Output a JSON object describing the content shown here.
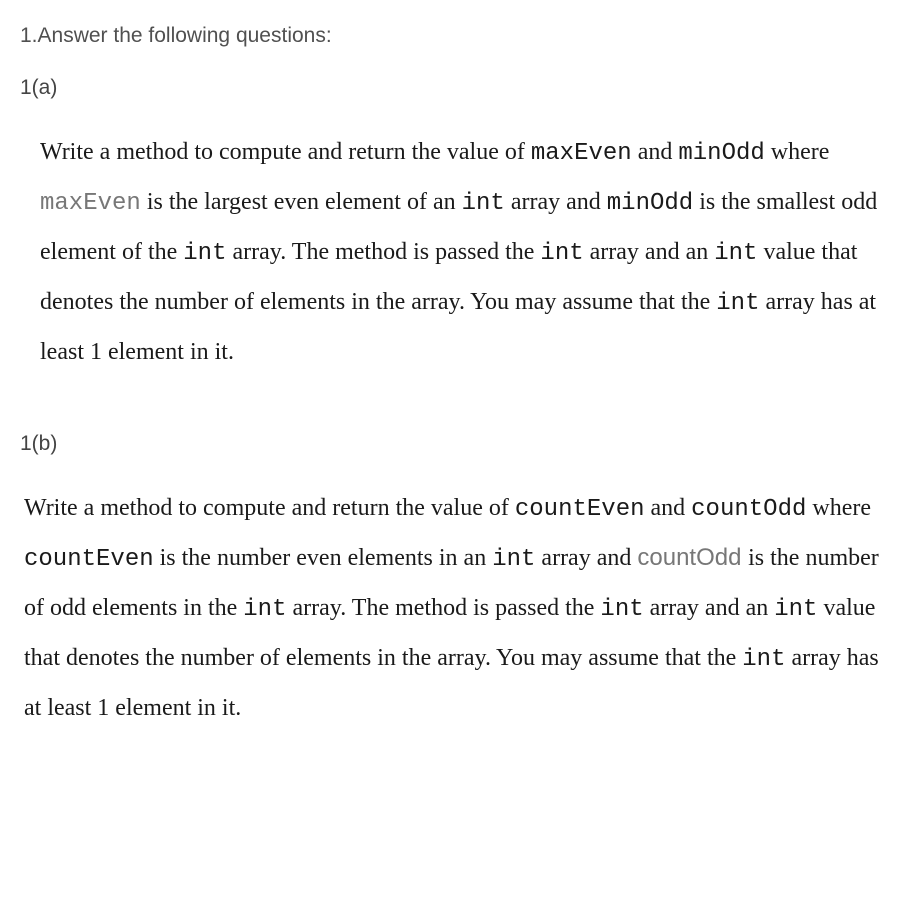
{
  "heading": "1.Answer the following questions:",
  "partA": {
    "label": "1(a)",
    "p1": "Write a method to compute and return the value of ",
    "c1": "maxEven",
    "p2": " and ",
    "c2": "minOdd",
    "p3": " where ",
    "c3": "maxEven",
    "p4": " is the largest even element of an ",
    "c4": "int",
    "p5": " array and ",
    "c5": "minOdd",
    "p6": " is the smallest odd element of the ",
    "c6": "int",
    "p7": " array. The method is passed the ",
    "c7": "int",
    "p8": " array and an ",
    "c8": "int",
    "p9": " value that denotes the number of elements in the array. You may assume that the ",
    "c9": "int",
    "p10": " array has at least 1 element in it."
  },
  "partB": {
    "label": "1(b)",
    "p1": "Write a method to compute and return the value of ",
    "c1": "countEven",
    "p2": " and ",
    "c2": "countOdd",
    "p3": " where ",
    "c3": "countEven",
    "p4": " is the number even elements in an ",
    "c4": "int",
    "p5": " array and ",
    "c5": "countOdd ",
    "p6": " is the number of odd elements in the ",
    "c6": "int",
    "p7": " array. The method is passed the ",
    "c7": "int",
    "p8": " array and an ",
    "c8": "int",
    "p9": " value that denotes the number of elements in the array. You may assume that the ",
    "c9": "int",
    "p10": " array has at least 1 element in it."
  }
}
